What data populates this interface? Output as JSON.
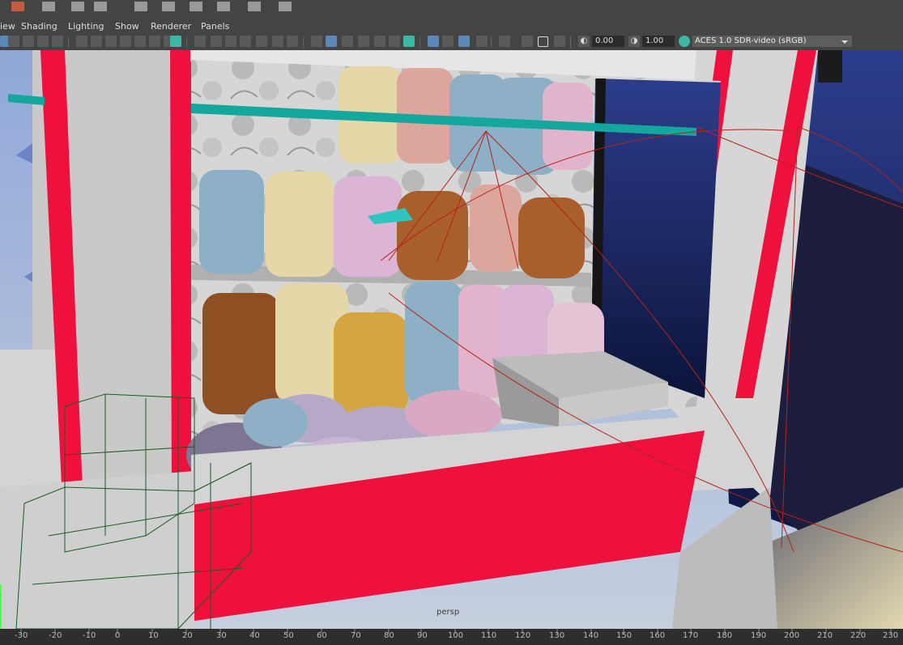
{
  "menu": [
    "iew",
    "Shading",
    "Lighting",
    "Show",
    "Renderer",
    "Panels"
  ],
  "toolbar": {
    "exposure_value": "0.00",
    "gamma_value": "1.00",
    "color_management": "ACES 1.0 SDR-video (sRGB)"
  },
  "viewport": {
    "camera_label": "persp"
  },
  "ruler": {
    "ticks": [
      "-30",
      "-20",
      "-10",
      "0",
      "10",
      "20",
      "30",
      "40",
      "50",
      "60",
      "70",
      "80",
      "90",
      "100",
      "110",
      "120",
      "130",
      "140",
      "150",
      "160",
      "170",
      "180",
      "190",
      "200",
      "210",
      "220",
      "230"
    ]
  },
  "colors": {
    "machine_red": "#f0103e",
    "machine_grey": "#c9c9c9",
    "window_blue": "#1d2a72",
    "accent_teal": "#13a79d",
    "wire_green": "#1d5a24"
  }
}
